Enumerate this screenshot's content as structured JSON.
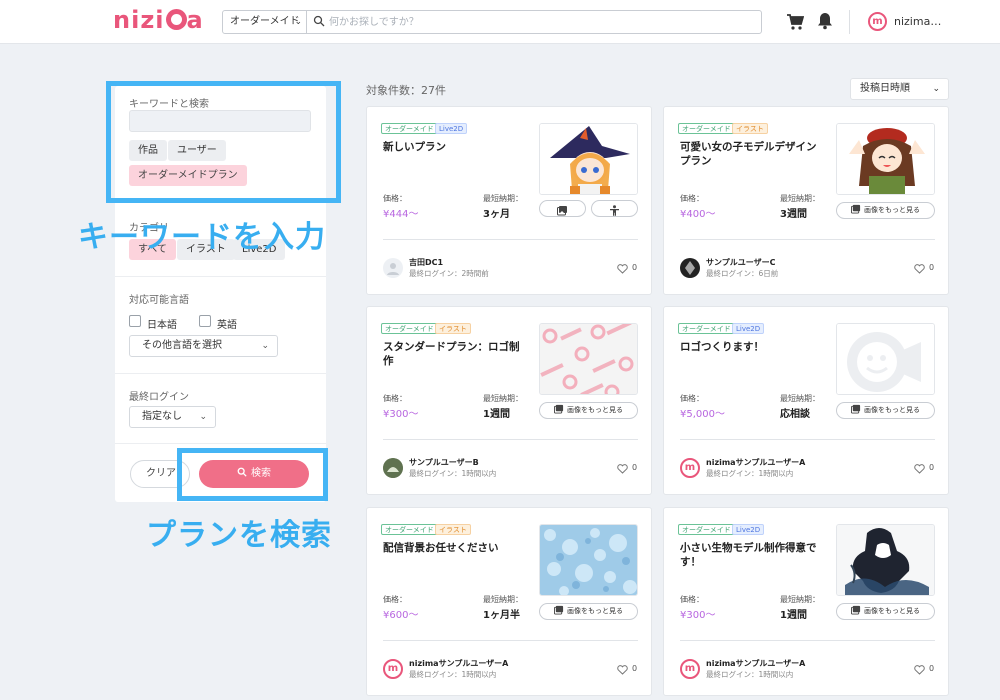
{
  "header": {
    "logo": "nizima",
    "search_category": "オーダーメイド",
    "search_placeholder": "何かお探しですか？",
    "user_name": "nizima…",
    "user_avatar_letter": "m"
  },
  "sidebar": {
    "keyword_label": "キーワードと検索",
    "keyword_value": "",
    "keyword_targets": [
      "作品",
      "ユーザー",
      "オーダーメイドプラン"
    ],
    "category_label": "カテゴリ",
    "categories": [
      "すべて",
      "イラスト",
      "Live2D"
    ],
    "language_label": "対応可能言語",
    "languages": [
      "日本語",
      "英語"
    ],
    "other_language": "その他言語を選択",
    "last_login_label": "最終ログイン",
    "last_login_value": "指定なし",
    "clear_label": "クリア",
    "search_label": "検索"
  },
  "annotations": {
    "keyword": "キーワードを入力",
    "search": "プランを検索"
  },
  "results": {
    "count_text": "対象件数：27件",
    "sort_value": "投稿日時順"
  },
  "labels": {
    "price": "価格：",
    "delivery": "最短納期：",
    "more_images": "画像をもっと見る"
  },
  "cards": [
    {
      "tags": [
        "オーダーメイド",
        "Live2D"
      ],
      "title": "新しいプラン",
      "price": "¥444〜",
      "delivery": "3ヶ月",
      "user": "吉田DC1",
      "login": "最終ログイン：2時間前",
      "likes": "0"
    },
    {
      "tags": [
        "オーダーメイド",
        "イラスト"
      ],
      "title": "可愛い女の子モデルデザインプラン",
      "price": "¥400〜",
      "delivery": "3週間",
      "user": "サンプルユーザーC",
      "login": "最終ログイン：6日前",
      "likes": "0"
    },
    {
      "tags": [
        "オーダーメイド",
        "イラスト"
      ],
      "title": "スタンダードプラン：ロゴ制作",
      "price": "¥300〜",
      "delivery": "1週間",
      "user": "サンプルユーザーB",
      "login": "最終ログイン：1時間以内",
      "likes": "0"
    },
    {
      "tags": [
        "オーダーメイド",
        "Live2D"
      ],
      "title": "ロゴつくります！",
      "price": "¥5,000〜",
      "delivery": "応相談",
      "user": "nizimaサンプルユーザーA",
      "login": "最終ログイン：1時間以内",
      "likes": "0"
    },
    {
      "tags": [
        "オーダーメイド",
        "イラスト"
      ],
      "title": "配信背景お任せください",
      "price": "¥600〜",
      "delivery": "1ヶ月半",
      "user": "nizimaサンプルユーザーA",
      "login": "最終ログイン：1時間以内",
      "likes": "0"
    },
    {
      "tags": [
        "オーダーメイド",
        "Live2D"
      ],
      "title": "小さい生物モデル制作得意です！",
      "price": "¥300〜",
      "delivery": "1週間",
      "user": "nizimaサンプルユーザーA",
      "login": "最終ログイン：1時間以内",
      "likes": "0"
    }
  ]
}
